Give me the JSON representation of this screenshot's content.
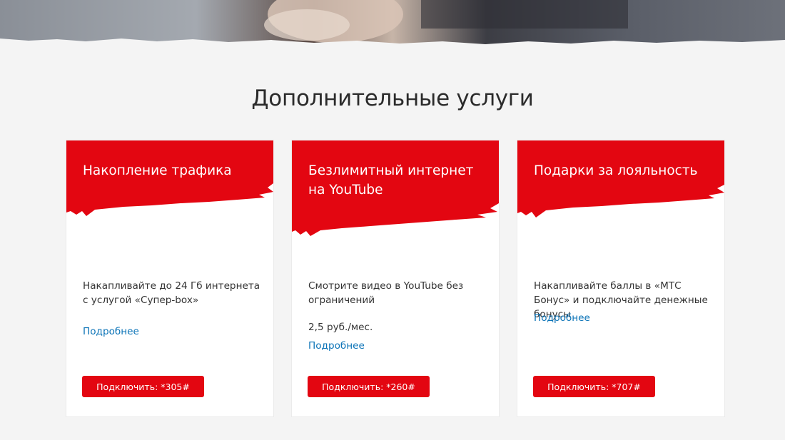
{
  "section": {
    "title": "Дополнительные услуги"
  },
  "colors": {
    "accent": "#e30611",
    "link": "#0b73b7",
    "background": "#f4f4f4"
  },
  "cards": [
    {
      "title": "Накопление трафика",
      "description": "Накапливайте до 24 Гб интернета с услугой «Супер-box»",
      "price": "",
      "link": "Подробнее",
      "button": "Подключить: *305#"
    },
    {
      "title": "Безлимитный интернет на YouTube",
      "description": "Смотрите видео в YouTube без ограничений",
      "price": "2,5 руб./мес.",
      "link": "Подробнее",
      "button": "Подключить: *260#"
    },
    {
      "title": "Подарки за лояльность",
      "description": "Накапливайте баллы в «МТС Бонус» и подключайте денежные бонусы",
      "price": "",
      "link": "Подробнее",
      "button": "Подключить: *707#"
    }
  ]
}
